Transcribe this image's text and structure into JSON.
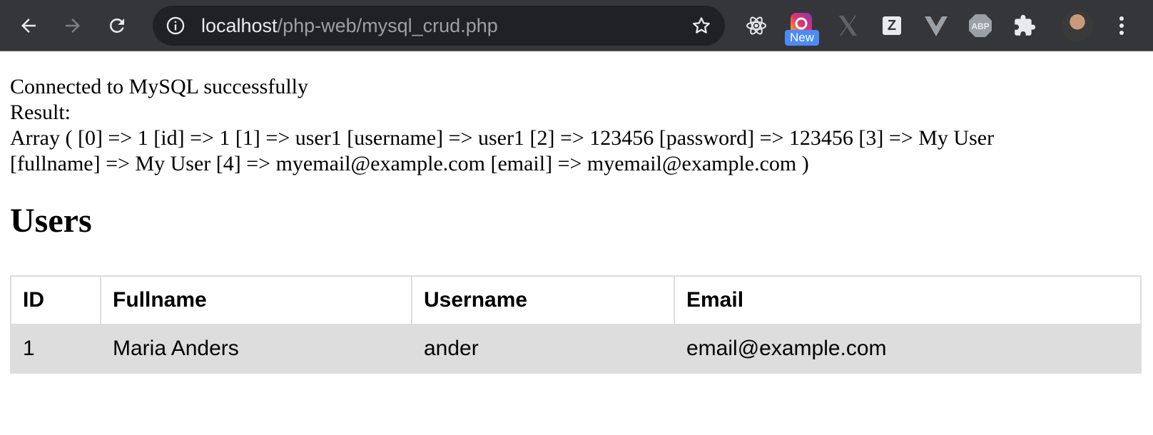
{
  "browser": {
    "url_host": "localhost",
    "url_path": "/php-web/mysql_crud.php",
    "extension_badge": "New",
    "extensions": [
      "react-devtools-icon",
      "instagram-like-icon",
      "x-icon",
      "z-icon",
      "vue-devtools-icon",
      "adblock-plus-icon",
      "puzzle-piece-icon"
    ],
    "abp_label": "ABP",
    "z_label": "Z"
  },
  "page": {
    "status_line": "Connected to MySQL successfully",
    "result_label": "Result:",
    "array_dump": "Array ( [0] => 1 [id] => 1 [1] => user1 [username] => user1 [2] => 123456 [password] => 123456 [3] => My User [fullname] => My User [4] => myemail@example.com [email] => myemail@example.com )",
    "heading": "Users"
  },
  "table": {
    "headers": [
      "ID",
      "Fullname",
      "Username",
      "Email"
    ],
    "rows": [
      [
        "1",
        "Maria Anders",
        "ander",
        "email@example.com"
      ]
    ]
  }
}
